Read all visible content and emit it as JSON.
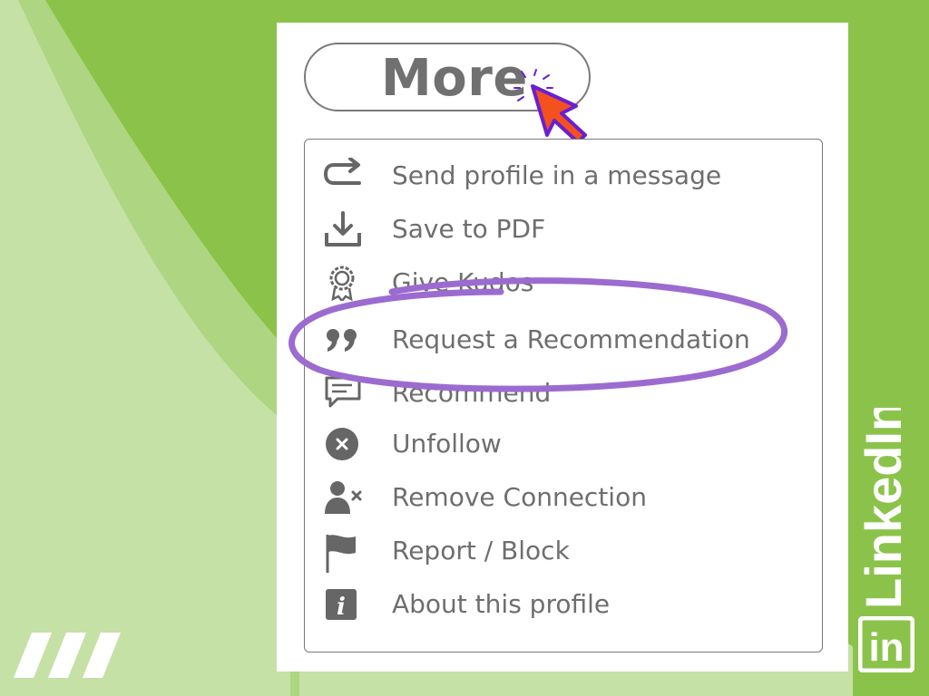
{
  "header": {
    "more_label": "More"
  },
  "menu": {
    "items": [
      {
        "icon": "share-arrow-icon",
        "label": "Send profile in a message"
      },
      {
        "icon": "download-icon",
        "label": "Save to PDF"
      },
      {
        "icon": "award-badge-icon",
        "label": "Give Kudos"
      },
      {
        "icon": "quote-icon",
        "label": "Request a Recommendation"
      },
      {
        "icon": "chat-bubble-icon",
        "label": "Recommend"
      },
      {
        "icon": "close-circle-icon",
        "label": "Unfollow"
      },
      {
        "icon": "remove-user-icon",
        "label": "Remove Connection"
      },
      {
        "icon": "flag-icon",
        "label": "Report / Block"
      },
      {
        "icon": "info-icon",
        "label": "About this profile"
      }
    ]
  },
  "branding": {
    "wordmark": "LinkedIn",
    "logo_text": "in"
  },
  "colors": {
    "background_green": "#8bc34a",
    "light_green": "#c5e1a5",
    "mid_green": "#aed581",
    "highlight_purple": "#9c6bd0",
    "cursor_orange": "#f4511e",
    "cursor_outline": "#6a1fd0",
    "text_gray": "#6e6e6e"
  }
}
